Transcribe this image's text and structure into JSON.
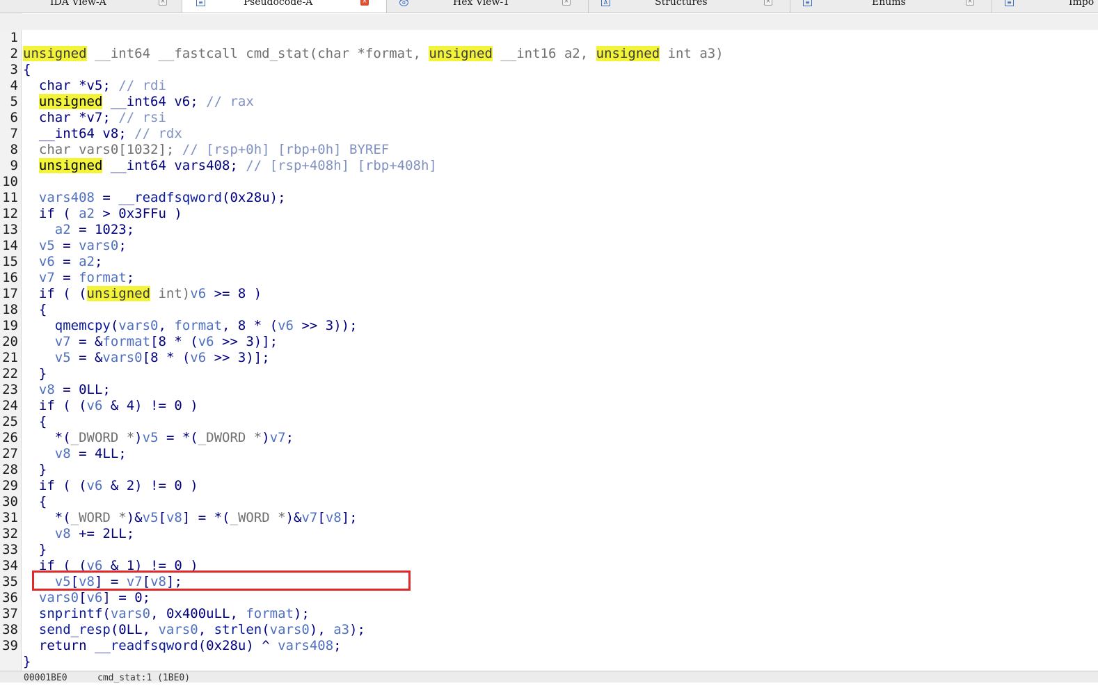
{
  "tabs": [
    {
      "label": "IDA View-A",
      "active": false,
      "icon": "disassembly-icon"
    },
    {
      "label": "Pseudocode-A",
      "active": true,
      "icon": "pseudocode-icon"
    },
    {
      "label": "Hex View-1",
      "active": false,
      "icon": "hex-icon"
    },
    {
      "label": "Structures",
      "active": false,
      "icon": "structures-icon"
    },
    {
      "label": "Enums",
      "active": false,
      "icon": "enums-icon"
    },
    {
      "label": "Impo",
      "active": false,
      "icon": "imports-icon"
    }
  ],
  "highlight_color": "#f3f33a",
  "annotation_color": "#e02828",
  "code": {
    "line_numbers": [
      "1",
      "2",
      "3",
      "4",
      "5",
      "6",
      "7",
      "8",
      "9",
      "10",
      "11",
      "12",
      "13",
      "14",
      "15",
      "16",
      "17",
      "18",
      "19",
      "20",
      "21",
      "22",
      "23",
      "24",
      "25",
      "26",
      "27",
      "28",
      "29",
      "30",
      "31",
      "32",
      "33",
      "34",
      "35",
      "36",
      "37",
      "38",
      "39"
    ],
    "l1": {
      "a": "unsigned",
      "b": " __int64 __fastcall cmd_stat(char *format, ",
      "c": "unsigned",
      "d": " __int16 a2, ",
      "e": "unsigned",
      "f": " int a3)"
    },
    "l2": "{",
    "l3": {
      "a": "char *v5; ",
      "b": "// rdi"
    },
    "l4": {
      "a": "unsigned",
      "b": " __int64 v6; ",
      "c": "// rax"
    },
    "l5": {
      "a": "char *v7; ",
      "b": "// rsi"
    },
    "l6": {
      "a": "__int64 v8; ",
      "b": "// rdx"
    },
    "l7": {
      "a": "char vars0[1032]; ",
      "b": "// [rsp+0h] [rbp+0h] BYREF"
    },
    "l8": {
      "a": "unsigned",
      "b": " __int64 vars408; ",
      "c": "// [rsp+408h] [rbp+408h]"
    },
    "l9": "",
    "l10": {
      "a": "vars408",
      "b": " = ",
      "c": "__readfsqword",
      "d": "(0x28u);"
    },
    "l11": {
      "a": "if ( ",
      "b": "a2",
      "c": " > 0x3FFu )"
    },
    "l12": {
      "a": "a2",
      "b": " = 1023;"
    },
    "l13": {
      "a": "v5",
      "b": " = ",
      "c": "vars0",
      "d": ";"
    },
    "l14": {
      "a": "v6",
      "b": " = ",
      "c": "a2",
      "d": ";"
    },
    "l15": {
      "a": "v7",
      "b": " = ",
      "c": "format",
      "d": ";"
    },
    "l16": {
      "a": "if ( (",
      "b": "unsigned",
      "c": " int)",
      "d": "v6",
      "e": " >= 8 )"
    },
    "l17": "{",
    "l18": {
      "a": "qmemcpy",
      "b": "(",
      "c": "vars0",
      "d": ", ",
      "e": "format",
      "f": ", 8 * (",
      "g": "v6",
      "h": " >> 3));"
    },
    "l19": {
      "a": "v7",
      "b": " = &",
      "c": "format",
      "d": "[8 * (",
      "e": "v6",
      "f": " >> 3)];"
    },
    "l20": {
      "a": "v5",
      "b": " = &",
      "c": "vars0",
      "d": "[8 * (",
      "e": "v6",
      "f": " >> 3)];"
    },
    "l21": "}",
    "l22": {
      "a": "v8",
      "b": " = 0LL;"
    },
    "l23": {
      "a": "if ( (",
      "b": "v6",
      "c": " & 4) != 0 )"
    },
    "l24": "{",
    "l25": {
      "a": "*(",
      "b": "_DWORD *",
      "c": ")",
      "d": "v5",
      "e": " = *(",
      "f": "_DWORD *",
      "g": ")",
      "h": "v7",
      "i": ";"
    },
    "l26": {
      "a": "v8",
      "b": " = 4LL;"
    },
    "l27": "}",
    "l28": {
      "a": "if ( (",
      "b": "v6",
      "c": " & 2) != 0 )"
    },
    "l29": "{",
    "l30": {
      "a": "*(",
      "b": "_WORD *",
      "c": ")&",
      "d": "v5",
      "e": "[",
      "f": "v8",
      "g": "] = *(",
      "h": "_WORD *",
      "i": ")&",
      "j": "v7",
      "k": "[",
      "l": "v8",
      "m": "];"
    },
    "l31": {
      "a": "v8",
      "b": " += 2LL;"
    },
    "l32": "}",
    "l33": {
      "a": "if ( (",
      "b": "v6",
      "c": " & 1) != 0 )"
    },
    "l34": {
      "a": "v5",
      "b": "[",
      "c": "v8",
      "d": "] = ",
      "e": "v7",
      "f": "[",
      "g": "v8",
      "h": "];"
    },
    "l35": {
      "a": "vars0",
      "b": "[",
      "c": "v6",
      "d": "] = 0;"
    },
    "l36": {
      "a": "snprintf",
      "b": "(",
      "c": "vars0",
      "d": ", 0x400uLL, ",
      "e": "format",
      "f": ");"
    },
    "l37": {
      "a": "send_resp",
      "b": "(0LL, ",
      "c": "vars0",
      "d": ", ",
      "e": "strlen",
      "f": "(",
      "g": "vars0",
      "h": "), ",
      "i": "a3",
      "j": ");"
    },
    "l38": {
      "a": "return ",
      "b": "__readfsqword",
      "c": "(0x28u) ^ ",
      "d": "vars408",
      "e": ";"
    },
    "l39": "}"
  },
  "status": {
    "address": "00001BE0",
    "location": "cmd_stat:1 (1BE0)"
  }
}
